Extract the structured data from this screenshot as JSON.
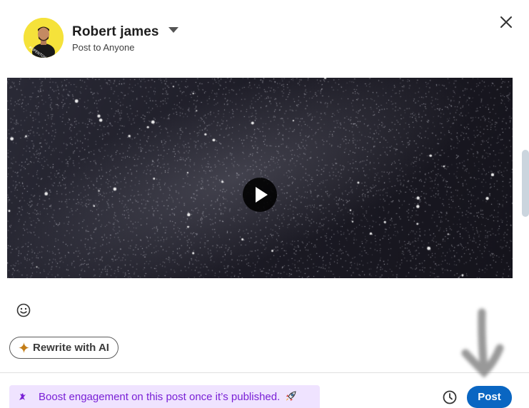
{
  "header": {
    "user_name": "Robert james",
    "audience": "Post to Anyone",
    "avatar_badge": "#OPENTOWORK",
    "close_icon": "close-icon",
    "caret_icon": "caret-down-icon"
  },
  "media": {
    "type": "video",
    "play_icon": "play-icon"
  },
  "toolbar": {
    "emoji_icon": "emoji-icon",
    "rewrite_label": "Rewrite with AI",
    "rewrite_icon": "sparkle-icon"
  },
  "footer": {
    "boost_text": "Boost engagement on this post once it’s published.",
    "boost_icon": "boost-icon",
    "rocket_icon": "rocket-icon",
    "schedule_icon": "clock-icon",
    "post_label": "Post"
  },
  "colors": {
    "primary": "#0a66c2",
    "boost_bg": "#efe3ff",
    "boost_text": "#7a20d6",
    "sparkle": "#c37d16"
  }
}
